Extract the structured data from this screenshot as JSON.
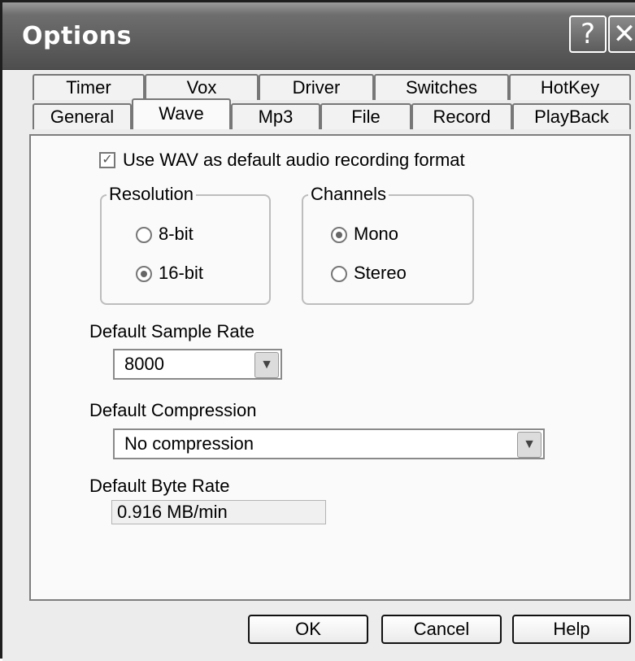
{
  "window": {
    "title": "Options",
    "help_glyph": "?",
    "close_glyph": "✕"
  },
  "tabs": {
    "row1": [
      "Timer",
      "Vox",
      "Driver",
      "Switches",
      "HotKey"
    ],
    "row2": [
      "General",
      "Wave",
      "Mp3",
      "File",
      "Record",
      "PlayBack"
    ],
    "selected": "Wave"
  },
  "wave": {
    "use_wav_label": "Use WAV as default audio recording format",
    "use_wav_checked": true,
    "check_glyph": "✓",
    "resolution": {
      "label": "Resolution",
      "options": [
        "8-bit",
        "16-bit"
      ],
      "selected": "16-bit"
    },
    "channels": {
      "label": "Channels",
      "options": [
        "Mono",
        "Stereo"
      ],
      "selected": "Mono"
    },
    "sample_rate": {
      "label": "Default Sample Rate",
      "value": "8000"
    },
    "compression": {
      "label": "Default Compression",
      "value": "No compression"
    },
    "byte_rate": {
      "label": "Default Byte Rate",
      "value": "0.916 MB/min"
    },
    "dropdown_glyph": "▼"
  },
  "buttons": {
    "ok": "OK",
    "cancel": "Cancel",
    "help": "Help"
  },
  "colors": {
    "titlebar": "#4e4e4e",
    "panel": "#fafafa",
    "dialog": "#ececec"
  }
}
